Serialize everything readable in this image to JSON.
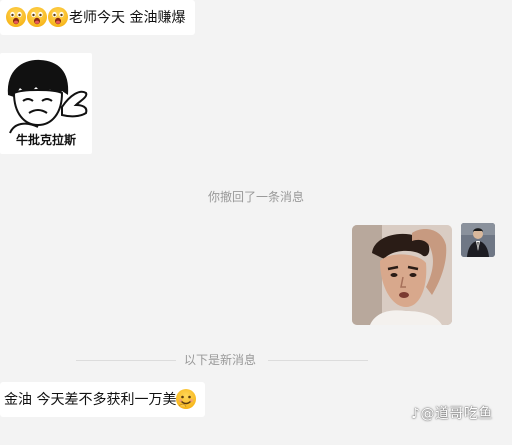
{
  "messages": [
    {
      "id": "msg1",
      "direction": "incoming",
      "emoji_count": 3,
      "emoji_icon": "surprised-face-emoji",
      "text": "老师今天 金油赚爆"
    },
    {
      "id": "msg2",
      "direction": "incoming",
      "sticker_caption": "牛批克拉斯"
    },
    {
      "id": "msg3",
      "direction": "outgoing",
      "photo_icon": "man-portrait-photo"
    },
    {
      "id": "msg4",
      "direction": "incoming",
      "text": "金油 今天差不多获利一万美",
      "trailing_emoji": "smiling-face-emoji"
    }
  ],
  "system_notice": "你撤回了一条消息",
  "divider_label": "以下是新消息",
  "watermark": "@道哥吃鱼",
  "colors": {
    "background": "#f3f3f3",
    "bubble_incoming": "#ffffff",
    "system_text": "#999999",
    "emoji_yellow": "#f8b81e"
  }
}
